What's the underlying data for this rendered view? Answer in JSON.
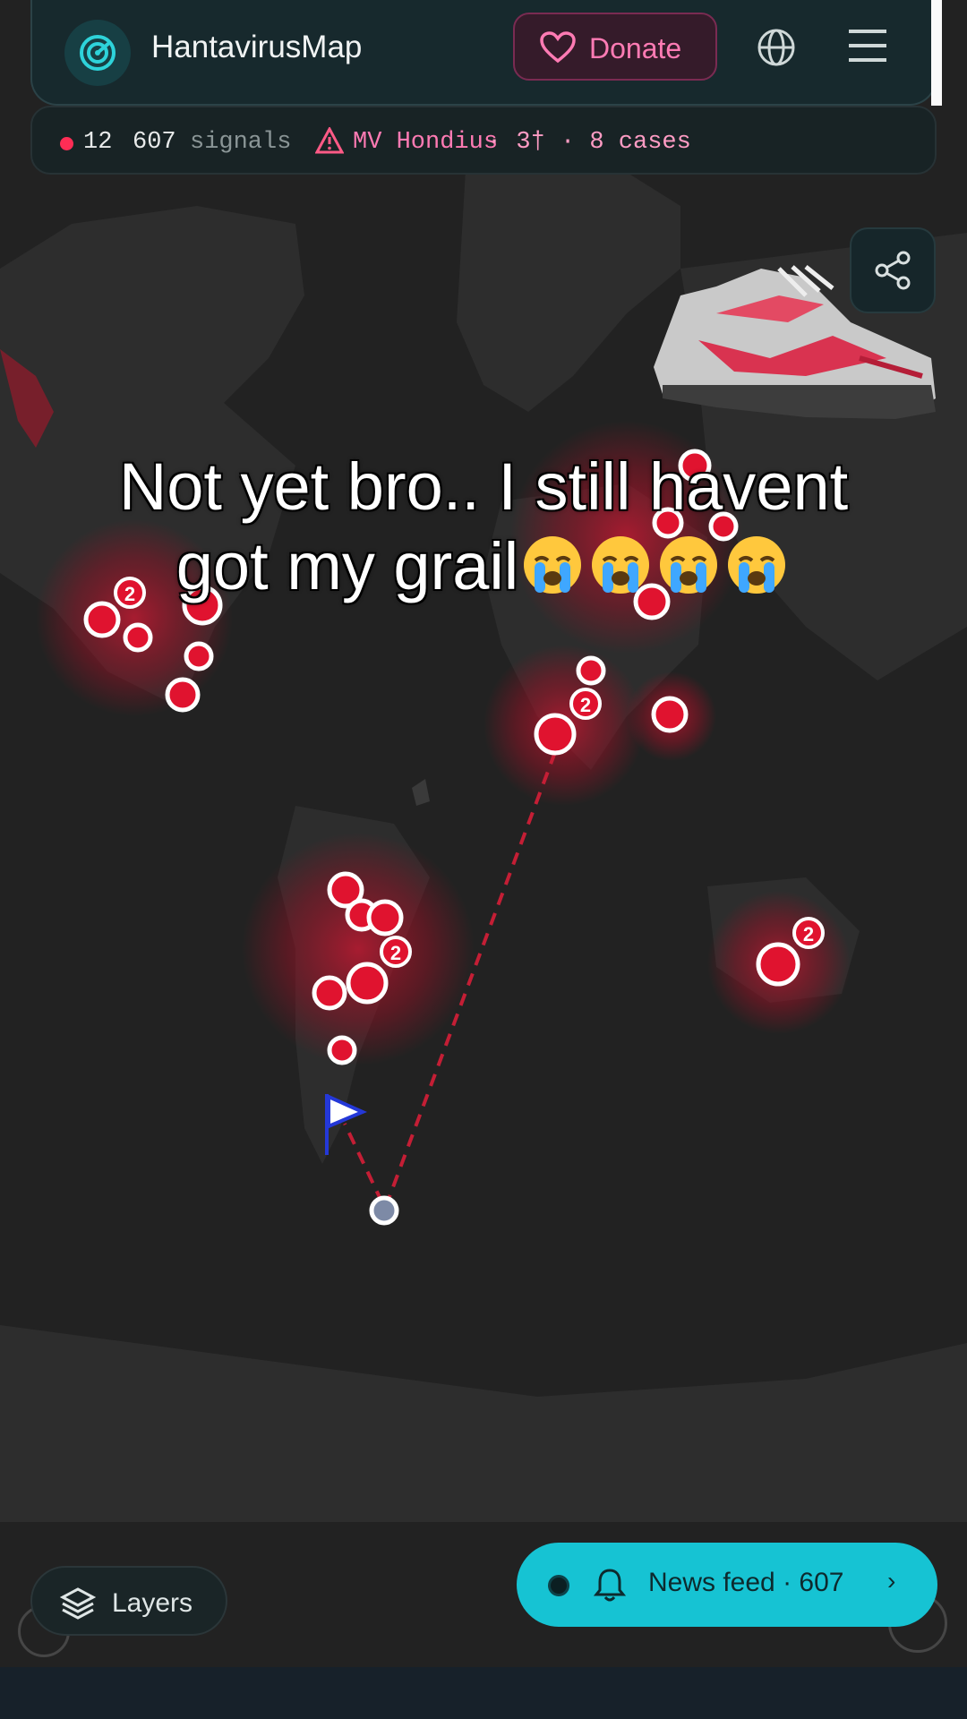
{
  "header": {
    "app_title": "HantavirusMap",
    "donate_label": "Donate"
  },
  "status": {
    "count": "12",
    "signals_number": "607",
    "signals_label": "signals",
    "ship_name": "MV Hondius",
    "deaths": "· 3†",
    "cases": "· 8 cases"
  },
  "caption": {
    "line1": "Not yet bro.. I still havent",
    "line2": "got my grail"
  },
  "controls": {
    "layers_label": "Layers",
    "news_feed_label": "News feed · 607",
    "news_feed_chevron": "›"
  },
  "cluster_labels": {
    "na": "2",
    "africa": "2",
    "sa": "2",
    "asia": "2"
  },
  "colors": {
    "accent_red": "#ff2d55",
    "accent_cyan": "#16c3d3",
    "donate_pink": "#ff7bb4"
  }
}
